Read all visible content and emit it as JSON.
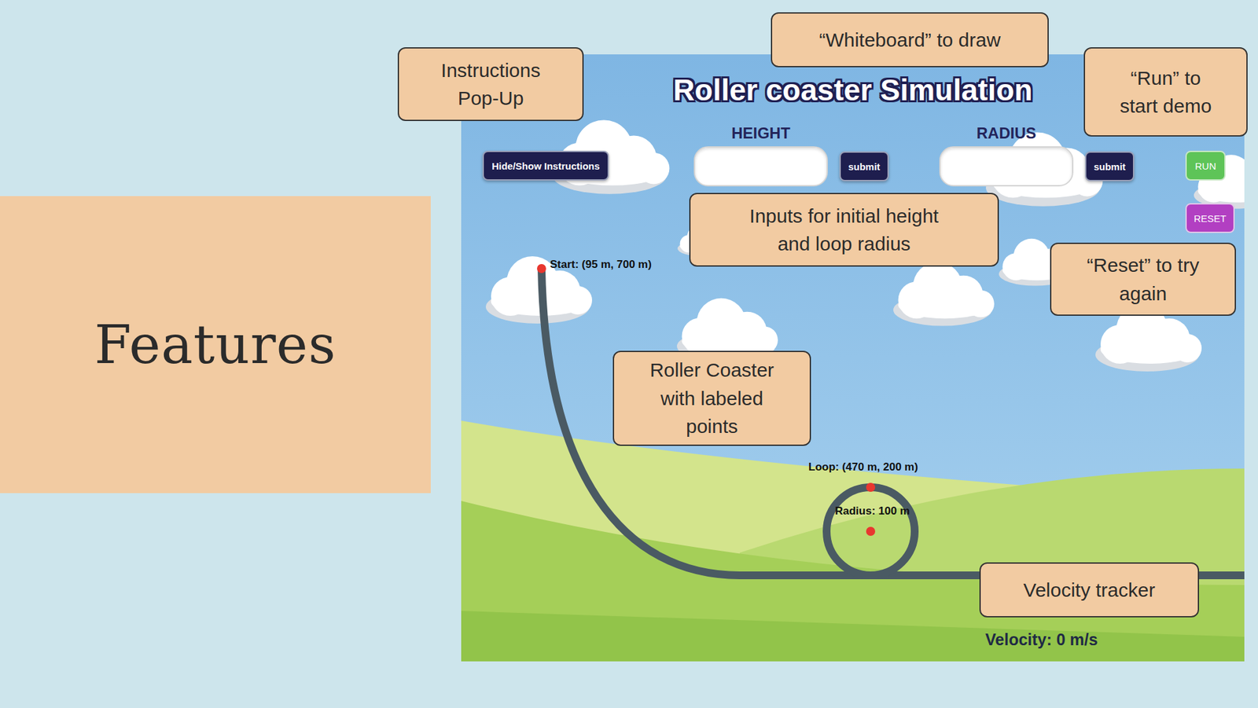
{
  "slide": {
    "title": "Features"
  },
  "app": {
    "title": "Roller coaster Simulation",
    "instructions_button": "Hide/Show Instructions",
    "inputs": [
      {
        "label": "HEIGHT",
        "value": "",
        "button": "submit"
      },
      {
        "label": "RADIUS",
        "value": "",
        "button": "submit"
      }
    ],
    "run_button": "RUN",
    "reset_button": "RESET",
    "track": {
      "start_label": "Start: (95 m, 700 m)",
      "loop_label": "Loop: (470 m, 200 m)",
      "radius_label": "Radius: 100 m"
    },
    "velocity": "Velocity: 0 m/s"
  },
  "callouts": [
    {
      "lines": [
        "Instructions",
        "Pop-Up"
      ]
    },
    {
      "lines": [
        "“Whiteboard” to draw"
      ]
    },
    {
      "lines": [
        "“Run” to",
        "start demo"
      ]
    },
    {
      "lines": [
        "Inputs for initial height",
        "and loop radius"
      ]
    },
    {
      "lines": [
        "“Reset” to try",
        "again"
      ]
    },
    {
      "lines": [
        "Roller Coaster",
        "with labeled",
        "points"
      ]
    },
    {
      "lines": [
        "Velocity tracker"
      ]
    }
  ]
}
